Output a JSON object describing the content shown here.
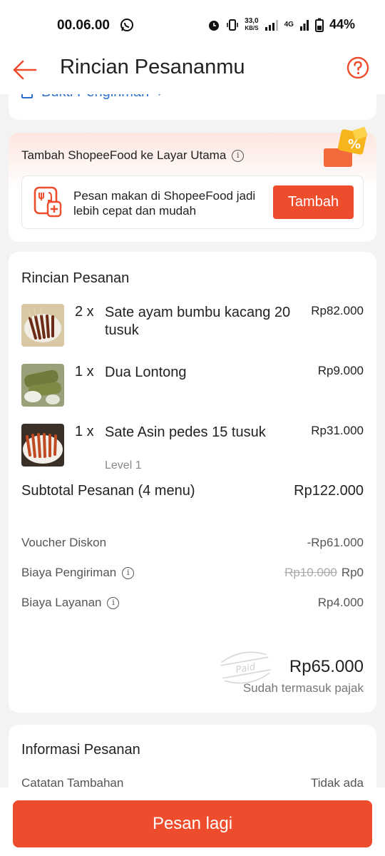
{
  "status_bar": {
    "time": "00.06.00",
    "net_speed_value": "33,0",
    "net_speed_unit": "KB/S",
    "network": "4G",
    "battery": "44%"
  },
  "header": {
    "title": "Rincian Pesananmu"
  },
  "proof": {
    "label": "Bukti Pengiriman"
  },
  "promo": {
    "title": "Tambah ShopeeFood ke Layar Utama",
    "text": "Pesan makan di ShopeeFood jadi lebih cepat dan mudah",
    "button": "Tambah"
  },
  "order": {
    "title": "Rincian Pesanan",
    "items": [
      {
        "qty": "2 x",
        "name": "Sate ayam bumbu kacang 20 tusuk",
        "price": "Rp82.000",
        "note": ""
      },
      {
        "qty": "1 x",
        "name": "Dua Lontong",
        "price": "Rp9.000",
        "note": ""
      },
      {
        "qty": "1 x",
        "name": "Sate Asin pedes 15 tusuk",
        "price": "Rp31.000",
        "note": "Level 1"
      }
    ],
    "subtotal_label": "Subtotal Pesanan (4 menu)",
    "subtotal_value": "Rp122.000",
    "voucher_label": "Voucher Diskon",
    "voucher_value": "-Rp61.000",
    "shipping_label": "Biaya Pengiriman",
    "shipping_original": "Rp10.000",
    "shipping_value": "Rp0",
    "service_label": "Biaya Layanan",
    "service_value": "Rp4.000",
    "stamp_text": "Paid",
    "total": "Rp65.000",
    "tax_note": "Sudah termasuk pajak"
  },
  "info": {
    "title": "Informasi Pesanan",
    "note_label": "Catatan Tambahan",
    "note_value": "Tidak ada"
  },
  "bottom": {
    "reorder_label": "Pesan lagi"
  },
  "colors": {
    "accent": "#ee4d2d",
    "link": "#2b6fd0"
  }
}
